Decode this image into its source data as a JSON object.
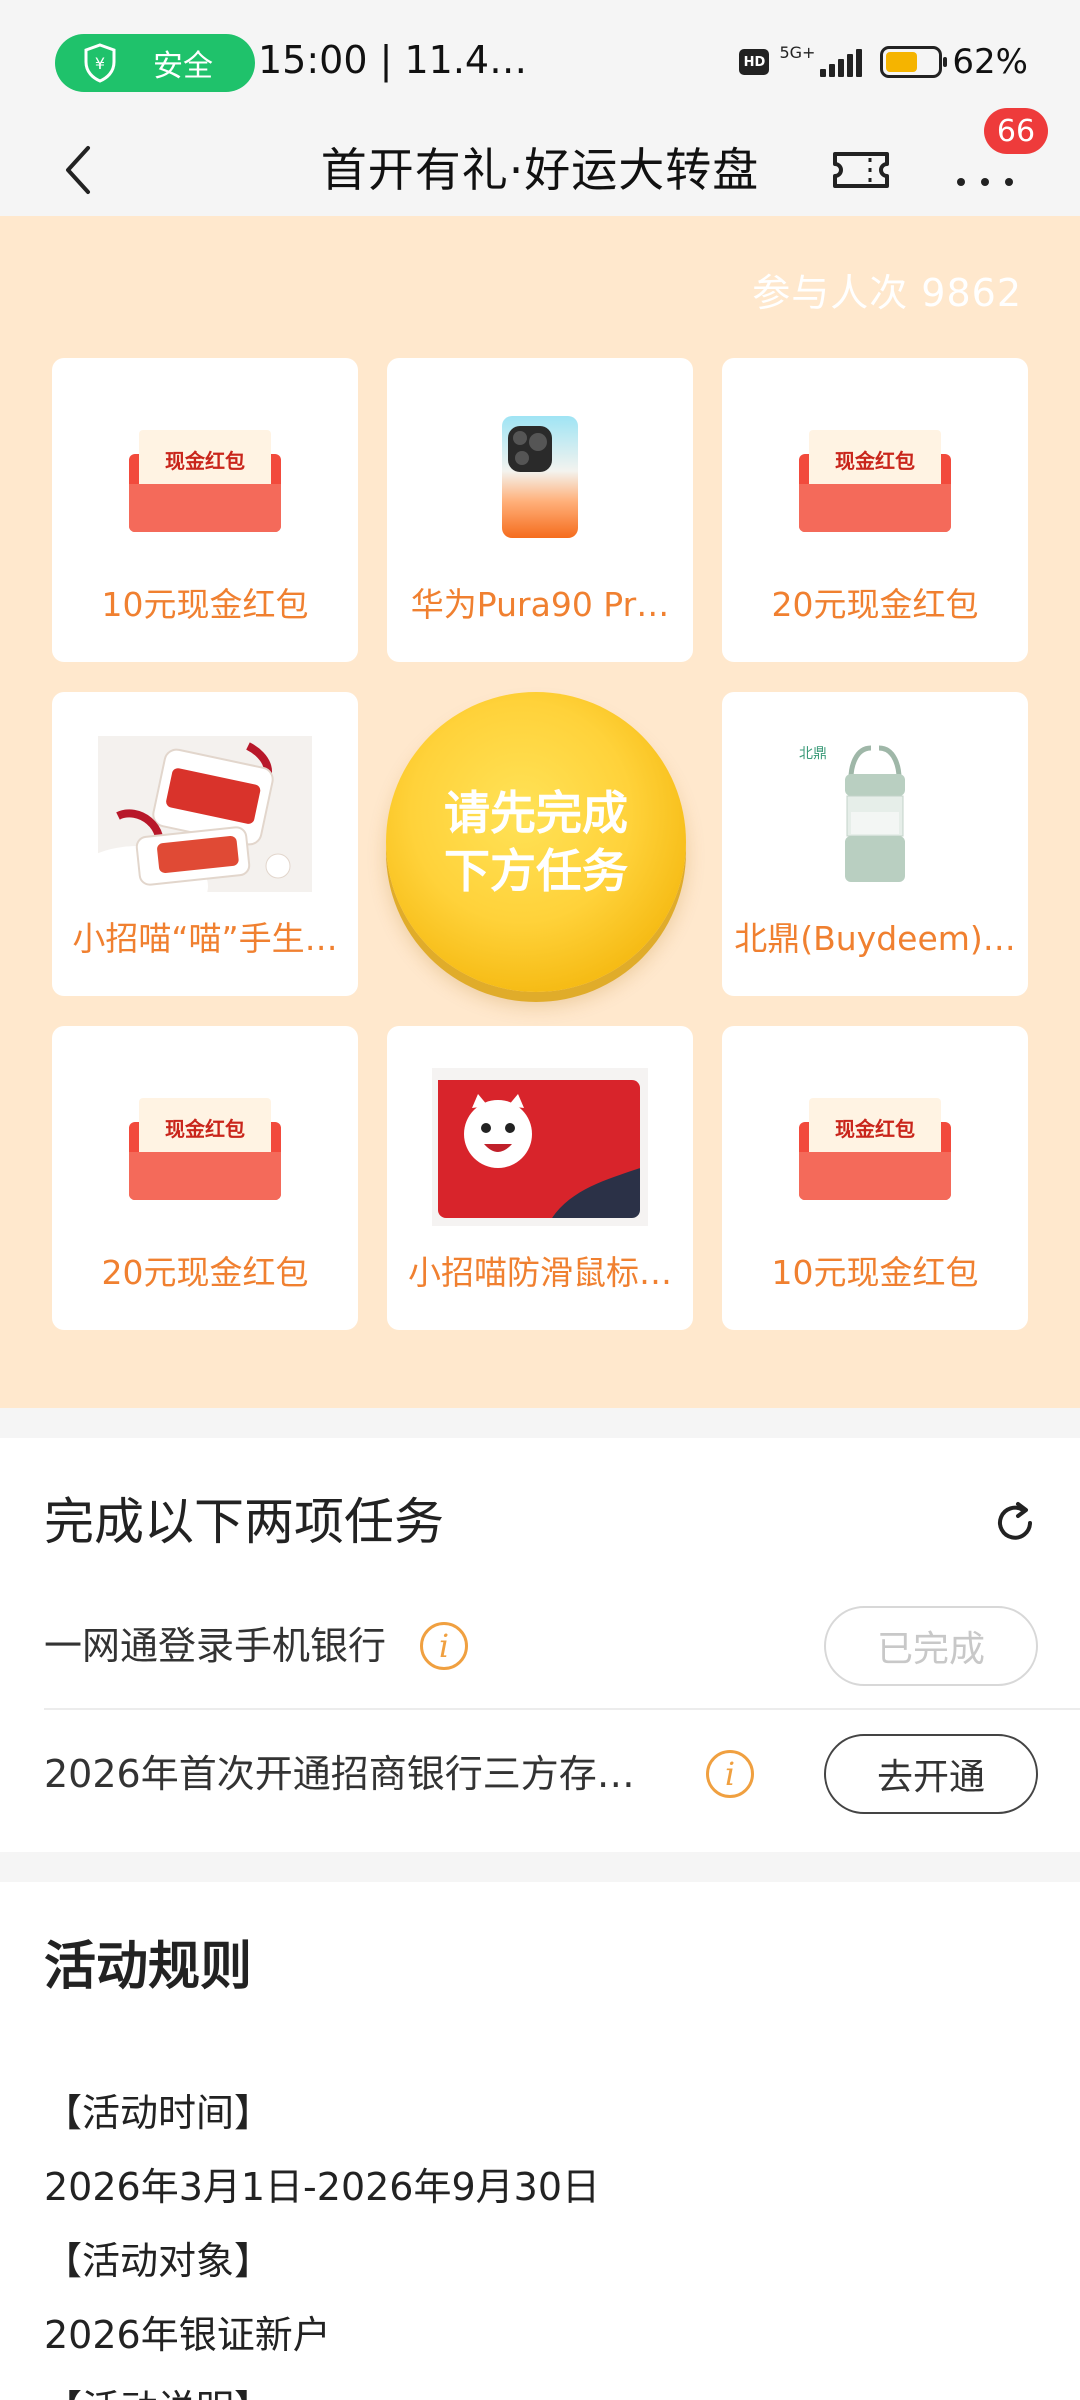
{
  "status_bar": {
    "safe_label": "安全",
    "time_text": "15:00 | 11.4…",
    "hd": "HD",
    "network": "5G+",
    "battery_percent": "62%",
    "battery_level": 0.62,
    "safe_color": "#1fc26b"
  },
  "nav": {
    "title": "首开有礼·好运大转盘",
    "back_icon": "chevron-left-icon",
    "ticket_icon": "ticket-icon",
    "more_icon": "more-dots-icon",
    "badge_count": "66"
  },
  "wheel": {
    "participants_text": "参与人次 9862",
    "spin_button_text": "请先完成下方任务",
    "prizes": [
      {
        "label": "10元现金红包",
        "image": "red-packet",
        "image_text": "现金红包"
      },
      {
        "label": "华为Pura90 Pr…",
        "image": "phone"
      },
      {
        "label": "20元现金红包",
        "image": "red-packet",
        "image_text": "现金红包"
      },
      {
        "label": "小招喵“喵”手生…",
        "image": "lanyard"
      },
      {
        "label": "北鼎(Buydeem)…",
        "image": "bottle",
        "image_text": "北鼎"
      },
      {
        "label": "20元现金红包",
        "image": "red-packet",
        "image_text": "现金红包"
      },
      {
        "label": "小招喵防滑鼠标…",
        "image": "mousepad"
      },
      {
        "label": "10元现金红包",
        "image": "red-packet",
        "image_text": "现金红包"
      }
    ],
    "background_color": "#ffe8cd",
    "accent_color": "#f08030"
  },
  "tasks": {
    "title": "完成以下两项任务",
    "refresh_icon": "refresh-icon",
    "items": [
      {
        "text": "一网通登录手机银行",
        "button": "已完成",
        "status": "done"
      },
      {
        "text": "2026年首次开通招商银行三方存…",
        "button": "去开通",
        "status": "todo"
      }
    ]
  },
  "rules": {
    "title": "活动规则",
    "lines": [
      "【活动时间】",
      "2026年3月1日-2026年9月30日",
      "【活动对象】",
      "2026年银证新户",
      "【活动说明】"
    ]
  }
}
